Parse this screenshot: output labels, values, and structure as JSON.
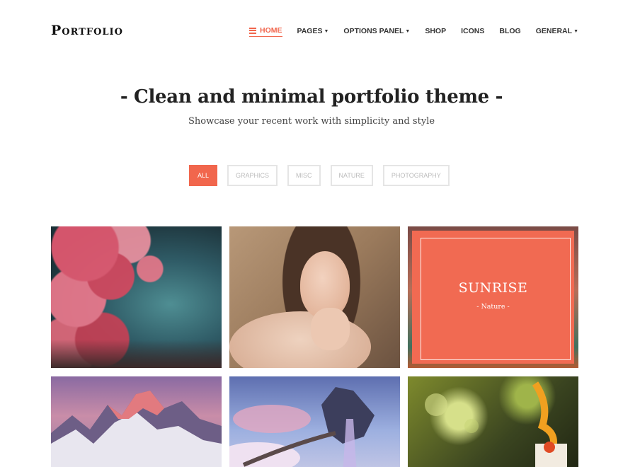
{
  "brand": {
    "logo": "Portfolio"
  },
  "nav": {
    "items": [
      {
        "label": "HOME",
        "active": true,
        "dropdown": false
      },
      {
        "label": "PAGES",
        "active": false,
        "dropdown": true
      },
      {
        "label": "OPTIONS PANEL",
        "active": false,
        "dropdown": true
      },
      {
        "label": "SHOP",
        "active": false,
        "dropdown": false
      },
      {
        "label": "ICONS",
        "active": false,
        "dropdown": false
      },
      {
        "label": "BLOG",
        "active": false,
        "dropdown": false
      },
      {
        "label": "GENERAL",
        "active": false,
        "dropdown": true
      }
    ],
    "menu_icon": "hamburger-icon",
    "dropdown_icon": "chevron-down-icon"
  },
  "hero": {
    "title": "- Clean and minimal portfolio theme -",
    "subtitle": "Showcase your recent work with simplicity and style"
  },
  "filters": [
    {
      "label": "ALL",
      "active": true
    },
    {
      "label": "GRAPHICS",
      "active": false
    },
    {
      "label": "MISC",
      "active": false
    },
    {
      "label": "NATURE",
      "active": false
    },
    {
      "label": "PHOTOGRAPHY",
      "active": false
    }
  ],
  "portfolio": {
    "hover_item": {
      "title": "SUNRISE",
      "category": "- Nature -"
    }
  },
  "colors": {
    "accent": "#f1664d",
    "text": "#222222",
    "filter_border": "#e5e5e5"
  }
}
